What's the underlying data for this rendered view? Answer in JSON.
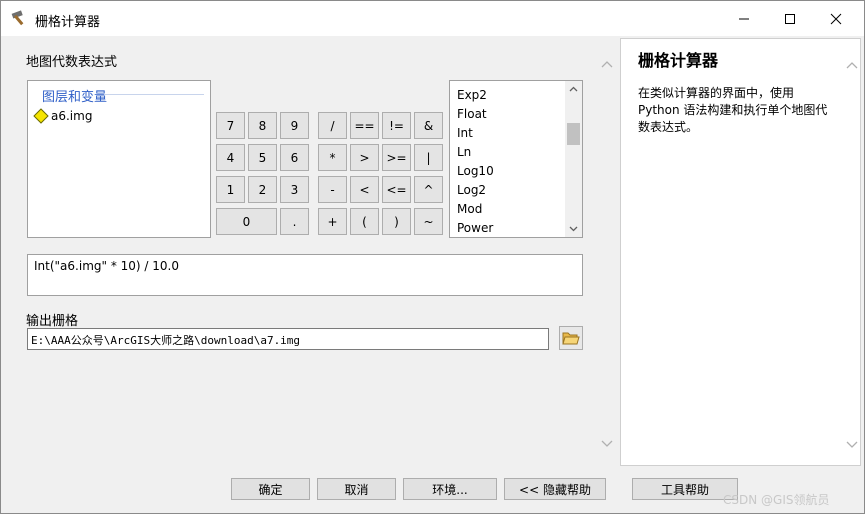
{
  "window": {
    "title": "栅格计算器",
    "controls": {
      "minimize": "minimize-icon",
      "maximize": "maximize-icon",
      "close": "close-icon"
    }
  },
  "left": {
    "expr_label": "地图代数表达式",
    "layers": {
      "header": "图层和变量",
      "items": [
        {
          "label": "a6.img",
          "icon": "raster-diamond-icon"
        }
      ]
    },
    "calculator": {
      "row1": [
        "7",
        "8",
        "9",
        "/",
        "==",
        "!=",
        "&"
      ],
      "row2": [
        "4",
        "5",
        "6",
        "*",
        ">",
        ">=",
        "|"
      ],
      "row3": [
        "1",
        "2",
        "3",
        "-",
        "<",
        "<=",
        "^"
      ],
      "row4": [
        "0",
        ".",
        "+",
        "(",
        ")",
        "~"
      ]
    },
    "functions": [
      "Exp2",
      "Float",
      "Int",
      "Ln",
      "Log10",
      "Log2",
      "Mod",
      "Power"
    ],
    "expression": "Int(\"a6.img\" * 10) / 10.0",
    "output_label": "输出栅格",
    "output_value": "E:\\AAA公众号\\ArcGIS大师之路\\download\\a7.img"
  },
  "help": {
    "title": "栅格计算器",
    "body": "在类似计算器的界面中，使用 Python 语法构建和执行单个地图代数表达式。"
  },
  "buttons": {
    "ok": "确定",
    "cancel": "取消",
    "env": "环境...",
    "hide_help": "<< 隐藏帮助",
    "tool_help": "工具帮助"
  },
  "watermark": "CSDN @GIS领航员",
  "colors": {
    "accent": "#3060c8",
    "diamond": "#f5e400"
  }
}
